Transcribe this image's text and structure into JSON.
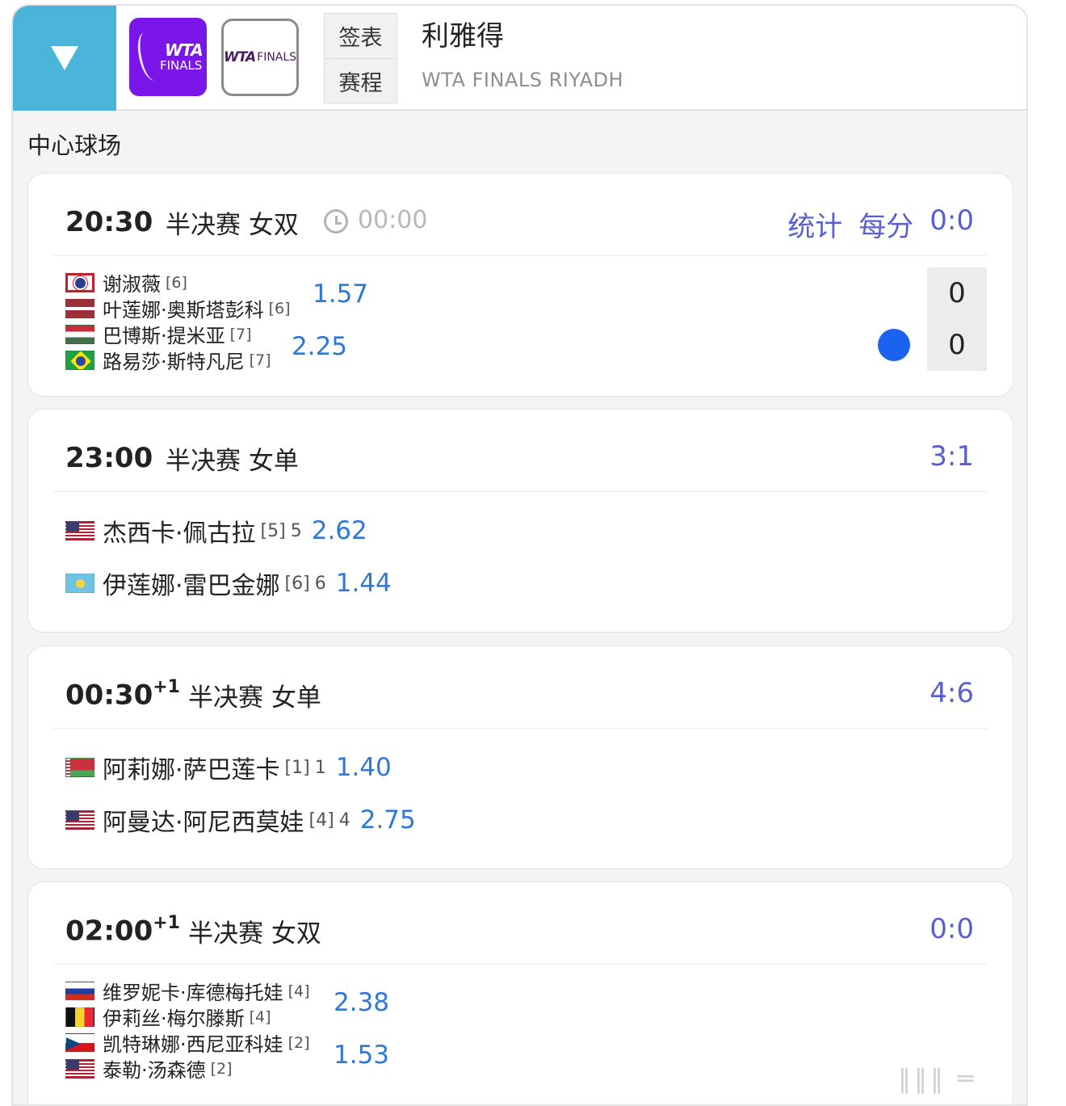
{
  "header": {
    "logo1_line1": "WTA",
    "logo1_line2": "FINALS",
    "logo2_line1": "WTA",
    "logo2_line2": "FINALS",
    "tab_draw": "签表",
    "tab_schedule": "赛程",
    "city": "利雅得",
    "event_en": "WTA FINALS RIYADH"
  },
  "court_name": "中心球场",
  "matches": [
    {
      "time": "20:30",
      "round": "半决赛 女双",
      "elapsed": "00:00",
      "stats_label": "统计",
      "per_point_label": "每分",
      "score": "0:0",
      "team1": [
        {
          "name": "谢淑薇",
          "seed": "[6]",
          "flag": "TPE"
        },
        {
          "name": "叶莲娜·奥斯塔彭科",
          "seed": "[6]",
          "flag": "LAT"
        }
      ],
      "team2": [
        {
          "name": "巴博斯·提米亚",
          "seed": "[7]",
          "flag": "HUN"
        },
        {
          "name": "路易莎·斯特凡尼",
          "seed": "[7]",
          "flag": "BRA"
        }
      ],
      "odds1": "1.57",
      "odds2": "2.25",
      "games1": "0",
      "games2": "0"
    },
    {
      "time": "23:00",
      "round": "半决赛 女单",
      "score": "3:1",
      "p1": {
        "name": "杰西卡·佩古拉",
        "seed": "[5]",
        "num": "5",
        "odds": "2.62",
        "flag": "USA"
      },
      "p2": {
        "name": "伊莲娜·雷巴金娜",
        "seed": "[6]",
        "num": "6",
        "odds": "1.44",
        "flag": "KAZ"
      }
    },
    {
      "time": "00:30",
      "day_offset": "+1",
      "round": "半决赛 女单",
      "score": "4:6",
      "p1": {
        "name": "阿莉娜·萨巴莲卡",
        "seed": "[1]",
        "num": "1",
        "odds": "1.40",
        "flag": "BLR"
      },
      "p2": {
        "name": "阿曼达·阿尼西莫娃",
        "seed": "[4]",
        "num": "4",
        "odds": "2.75",
        "flag": "USA"
      }
    },
    {
      "time": "02:00",
      "day_offset": "+1",
      "round": "半决赛 女双",
      "score": "0:0",
      "team1": [
        {
          "name": "维罗妮卡·库德梅托娃",
          "seed": "[4]",
          "flag": "RUS"
        },
        {
          "name": "伊莉丝·梅尔滕斯",
          "seed": "[4]",
          "flag": "BEL"
        }
      ],
      "team2": [
        {
          "name": "凯特琳娜·西尼亚科娃",
          "seed": "[2]",
          "flag": "CZE"
        },
        {
          "name": "泰勒·汤森德",
          "seed": "[2]",
          "flag": "USA"
        }
      ],
      "odds1": "2.38",
      "odds2": "1.53"
    }
  ],
  "colors": {
    "header_toggle": "#4bb4d9",
    "logo_purple": "#7a16ea",
    "accent_blue": "#2f78d8",
    "score_violet": "#5a5fd0",
    "serve_dot": "#1a63f0"
  }
}
